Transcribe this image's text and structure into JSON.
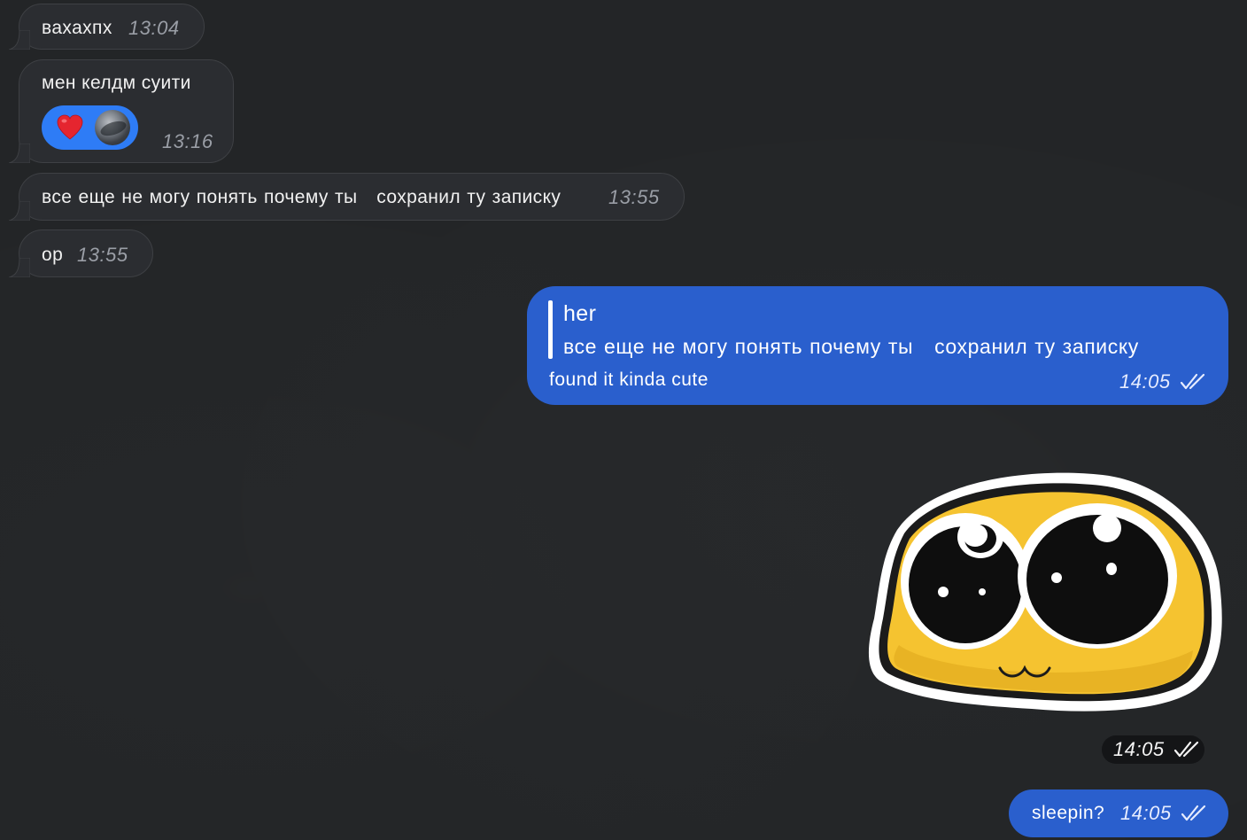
{
  "chat": {
    "messages": [
      {
        "direction": "incoming",
        "text": "вахахпх",
        "time": "13:04"
      },
      {
        "direction": "incoming",
        "text": "мен келдм суити",
        "time": "13:16",
        "reaction": {
          "emoji_icon": "heart-emoji",
          "reactor": "avatar"
        }
      },
      {
        "direction": "incoming",
        "text": "все еще не могу понять почему ты   сохранил ту записку",
        "time": "13:55"
      },
      {
        "direction": "incoming",
        "text": "ор",
        "time": "13:55"
      },
      {
        "direction": "outgoing",
        "reply": {
          "author": "her",
          "text": "все еще не могу понять почему ты   сохранил ту записку"
        },
        "text": "found it kinda cute",
        "time": "14:05",
        "status": "read"
      },
      {
        "direction": "outgoing",
        "type": "sticker",
        "sticker_icon": "pleading-face-sticker",
        "time": "14:05",
        "status": "read"
      },
      {
        "direction": "outgoing",
        "text": "sleepin?",
        "time": "14:05",
        "status": "read"
      }
    ]
  },
  "colors": {
    "background": "#232527",
    "incoming_bubble": "#2b2d31",
    "outgoing_bubble": "#2a5fcd",
    "reaction_pill": "#2e7cf6"
  }
}
